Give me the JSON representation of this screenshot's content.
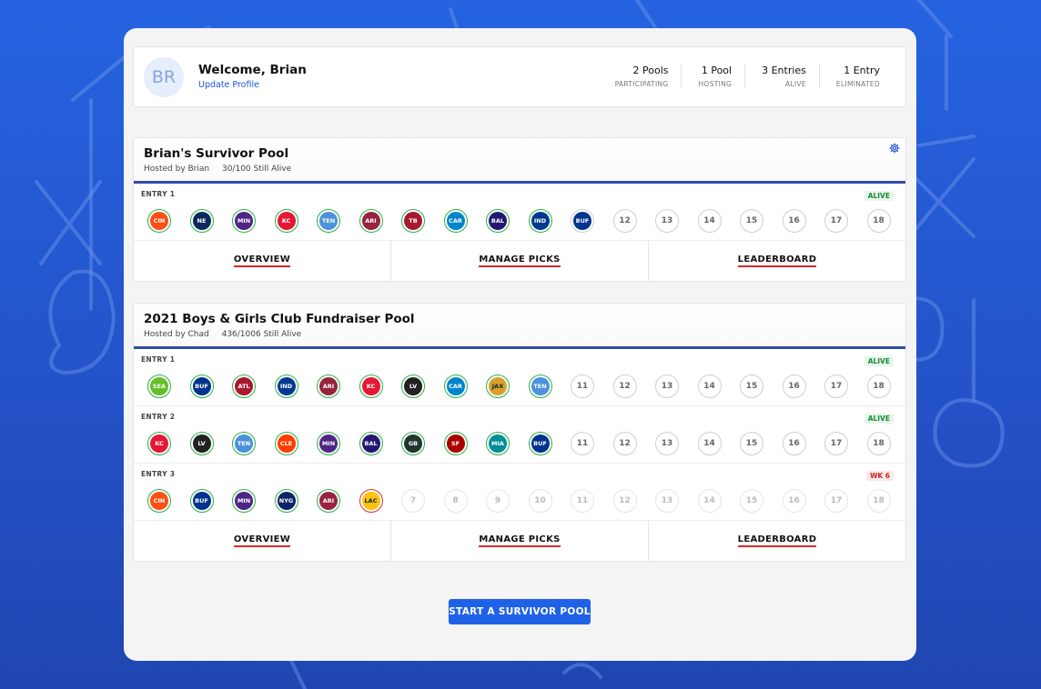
{
  "profile": {
    "initials": "BR",
    "welcome": "Welcome, Brian",
    "update_link": "Update Profile",
    "stats": [
      {
        "value": "2 Pools",
        "label": "PARTICIPATING"
      },
      {
        "value": "1 Pool",
        "label": "HOSTING"
      },
      {
        "value": "3 Entries",
        "label": "ALIVE"
      },
      {
        "value": "1 Entry",
        "label": "ELIMINATED"
      }
    ]
  },
  "pool1": {
    "title": "Brian's Survivor Pool",
    "hosted_by": "Hosted by Brian",
    "alive": "30/100 Still Alive",
    "entries": [
      {
        "label": "ENTRY 1",
        "status": "ALIVE",
        "weeks": [
          {
            "type": "picked",
            "logo": "CIN",
            "icon": "bengals-logo-icon"
          },
          {
            "type": "picked",
            "logo": "NE",
            "icon": "patriots-logo-icon"
          },
          {
            "type": "picked",
            "logo": "MIN",
            "icon": "vikings-logo-icon"
          },
          {
            "type": "picked",
            "logo": "KC",
            "icon": "chiefs-logo-icon"
          },
          {
            "type": "picked",
            "logo": "TEN",
            "icon": "titans-logo-icon"
          },
          {
            "type": "picked",
            "logo": "ARI",
            "icon": "cardinals-logo-icon"
          },
          {
            "type": "picked",
            "logo": "TB",
            "icon": "buccaneers-logo-icon"
          },
          {
            "type": "picked",
            "logo": "CAR",
            "icon": "panthers-logo-icon"
          },
          {
            "type": "picked",
            "logo": "BAL",
            "icon": "ravens-logo-icon"
          },
          {
            "type": "picked",
            "logo": "IND",
            "icon": "colts-logo-icon"
          },
          {
            "type": "pending",
            "logo": "BUF",
            "icon": "bills-logo-icon"
          },
          {
            "type": "open",
            "num": "12"
          },
          {
            "type": "open",
            "num": "13"
          },
          {
            "type": "open",
            "num": "14"
          },
          {
            "type": "open",
            "num": "15"
          },
          {
            "type": "open",
            "num": "16"
          },
          {
            "type": "open",
            "num": "17"
          },
          {
            "type": "open",
            "num": "18"
          }
        ]
      }
    ]
  },
  "pool2": {
    "title": "2021 Boys & Girls Club Fundraiser Pool",
    "hosted_by": "Hosted by Chad",
    "alive": "436/1006 Still Alive",
    "entries": [
      {
        "label": "ENTRY 1",
        "status": "ALIVE",
        "weeks": [
          {
            "type": "picked",
            "logo": "SEA",
            "icon": "seahawks-logo-icon"
          },
          {
            "type": "picked",
            "logo": "BUF",
            "icon": "bills-logo-icon"
          },
          {
            "type": "picked",
            "logo": "ATL",
            "icon": "falcons-logo-icon"
          },
          {
            "type": "picked",
            "logo": "IND",
            "icon": "colts-logo-icon"
          },
          {
            "type": "picked",
            "logo": "ARI",
            "icon": "cardinals-logo-icon"
          },
          {
            "type": "picked",
            "logo": "KC",
            "icon": "chiefs-logo-icon"
          },
          {
            "type": "picked",
            "logo": "LV",
            "icon": "raiders-logo-icon"
          },
          {
            "type": "picked",
            "logo": "CAR",
            "icon": "panthers-logo-icon"
          },
          {
            "type": "picked",
            "logo": "JAX",
            "icon": "jaguars-logo-icon"
          },
          {
            "type": "picked",
            "logo": "TEN",
            "icon": "titans-logo-icon"
          },
          {
            "type": "open",
            "num": "11"
          },
          {
            "type": "open",
            "num": "12"
          },
          {
            "type": "open",
            "num": "13"
          },
          {
            "type": "open",
            "num": "14"
          },
          {
            "type": "open",
            "num": "15"
          },
          {
            "type": "open",
            "num": "16"
          },
          {
            "type": "open",
            "num": "17"
          },
          {
            "type": "open",
            "num": "18"
          }
        ]
      },
      {
        "label": "ENTRY 2",
        "status": "ALIVE",
        "weeks": [
          {
            "type": "picked",
            "logo": "KC",
            "icon": "chiefs-logo-icon"
          },
          {
            "type": "picked",
            "logo": "LV",
            "icon": "raiders-logo-icon"
          },
          {
            "type": "picked",
            "logo": "TEN",
            "icon": "titans-logo-icon"
          },
          {
            "type": "picked",
            "logo": "CLE",
            "icon": "browns-logo-icon"
          },
          {
            "type": "picked",
            "logo": "MIN",
            "icon": "vikings-logo-icon"
          },
          {
            "type": "picked",
            "logo": "BAL",
            "icon": "ravens-logo-icon"
          },
          {
            "type": "picked",
            "logo": "GB",
            "icon": "packers-logo-icon"
          },
          {
            "type": "picked",
            "logo": "SF",
            "icon": "49ers-logo-icon"
          },
          {
            "type": "picked",
            "logo": "MIA",
            "icon": "dolphins-logo-icon"
          },
          {
            "type": "picked",
            "logo": "BUF",
            "icon": "bills-logo-icon"
          },
          {
            "type": "open",
            "num": "11"
          },
          {
            "type": "open",
            "num": "12"
          },
          {
            "type": "open",
            "num": "13"
          },
          {
            "type": "open",
            "num": "14"
          },
          {
            "type": "open",
            "num": "15"
          },
          {
            "type": "open",
            "num": "16"
          },
          {
            "type": "open",
            "num": "17"
          },
          {
            "type": "open",
            "num": "18"
          }
        ]
      },
      {
        "label": "ENTRY 3",
        "status": "WK 6",
        "weeks": [
          {
            "type": "picked",
            "logo": "CIN",
            "icon": "bengals-logo-icon"
          },
          {
            "type": "picked",
            "logo": "BUF",
            "icon": "bills-logo-icon"
          },
          {
            "type": "picked",
            "logo": "MIN",
            "icon": "vikings-logo-icon"
          },
          {
            "type": "picked",
            "logo": "NYG",
            "icon": "giants-logo-icon"
          },
          {
            "type": "picked",
            "logo": "ARI",
            "icon": "cardinals-logo-icon"
          },
          {
            "type": "lost",
            "logo": "LAC",
            "icon": "chargers-logo-icon"
          },
          {
            "type": "future",
            "num": "7"
          },
          {
            "type": "future",
            "num": "8"
          },
          {
            "type": "future",
            "num": "9"
          },
          {
            "type": "future",
            "num": "10"
          },
          {
            "type": "future",
            "num": "11"
          },
          {
            "type": "future",
            "num": "12"
          },
          {
            "type": "future",
            "num": "13"
          },
          {
            "type": "future",
            "num": "14"
          },
          {
            "type": "future",
            "num": "15"
          },
          {
            "type": "future",
            "num": "16"
          },
          {
            "type": "future",
            "num": "17"
          },
          {
            "type": "future",
            "num": "18"
          }
        ]
      }
    ]
  },
  "tabs": {
    "overview": "OVERVIEW",
    "manage_picks": "MANAGE PICKS",
    "leaderboard": "LEADERBOARD"
  },
  "cta_label": "START A SURVIVOR POOL",
  "team_colors": {
    "CIN": "#fb4f14",
    "NE": "#0b2a5b",
    "MIN": "#4f2683",
    "KC": "#e31837",
    "TEN": "#4b92db",
    "ARI": "#97233f",
    "TB": "#a71930",
    "CAR": "#0085ca",
    "BAL": "#241773",
    "IND": "#003a8f",
    "BUF": "#00338d",
    "SEA": "#69be28",
    "ATL": "#a71930",
    "LV": "#222222",
    "JAX": "#d7a22a",
    "CLE": "#ff3c00",
    "GB": "#203731",
    "SF": "#aa0000",
    "MIA": "#008e97",
    "NYG": "#0b2265",
    "LAC": "#ffc20e"
  },
  "colors": {
    "accent": "#1f62e8",
    "alive": "#1b8a3a",
    "eliminated": "#c62828",
    "pick_ring": "#2fb04a",
    "loss_ring": "#e03434"
  }
}
